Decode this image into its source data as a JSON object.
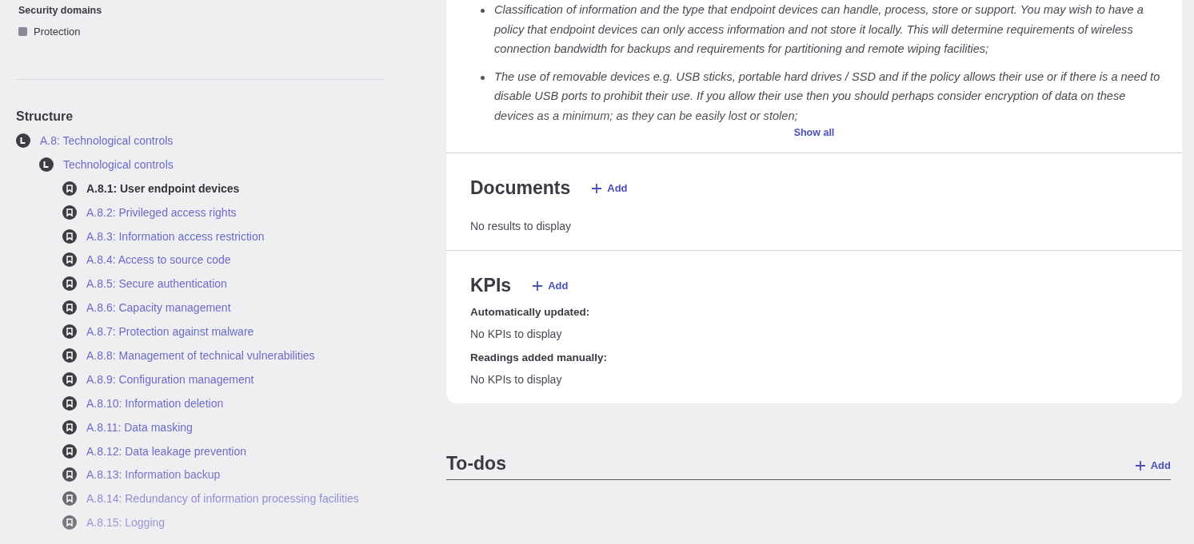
{
  "sidebar": {
    "security_domains": {
      "title": "Security domains",
      "items": [
        {
          "label": "Protection",
          "color": "#8a8796"
        }
      ]
    },
    "structure": {
      "title": "Structure",
      "tree": [
        {
          "label": "A.8: Technological controls",
          "kind": "group",
          "selected": false,
          "children": [
            {
              "label": "Technological controls",
              "kind": "group",
              "selected": false,
              "children": [
                {
                  "label": "A.8.1: User endpoint devices",
                  "kind": "control",
                  "selected": true
                },
                {
                  "label": "A.8.2: Privileged access rights",
                  "kind": "control",
                  "selected": false
                },
                {
                  "label": "A.8.3: Information access restriction",
                  "kind": "control",
                  "selected": false
                },
                {
                  "label": "A.8.4: Access to source code",
                  "kind": "control",
                  "selected": false
                },
                {
                  "label": "A.8.5: Secure authentication",
                  "kind": "control",
                  "selected": false
                },
                {
                  "label": "A.8.6: Capacity management",
                  "kind": "control",
                  "selected": false
                },
                {
                  "label": "A.8.7: Protection against malware",
                  "kind": "control",
                  "selected": false
                },
                {
                  "label": "A.8.8: Management of technical vulnerabilities",
                  "kind": "control",
                  "selected": false
                },
                {
                  "label": "A.8.9: Configuration management",
                  "kind": "control",
                  "selected": false
                },
                {
                  "label": "A.8.10: Information deletion",
                  "kind": "control",
                  "selected": false
                },
                {
                  "label": "A.8.11: Data masking",
                  "kind": "control",
                  "selected": false
                },
                {
                  "label": "A.8.12: Data leakage prevention",
                  "kind": "control",
                  "selected": false
                },
                {
                  "label": "A.8.13: Information backup",
                  "kind": "control",
                  "selected": false
                },
                {
                  "label": "A.8.14: Redundancy of information processing facilities",
                  "kind": "control",
                  "selected": false
                },
                {
                  "label": "A.8.15: Logging",
                  "kind": "control",
                  "selected": false
                }
              ]
            }
          ]
        }
      ]
    }
  },
  "description": {
    "bullets": [
      "Classification of information and the type that endpoint devices can handle, process, store or support. You may wish to have a policy that endpoint devices can only access information and not store it locally. This will determine requirements of wireless connection bandwidth for backups and requirements for partitioning and remote wiping facilities;",
      "The use of removable devices e.g. USB sticks, portable hard drives / SSD and if the policy allows their use or if there is a need to disable USB ports to prohibit their use. If you allow their use then you should perhaps consider encryption of data on these devices as a minimum; as they can be easily lost or stolen;"
    ],
    "show_all": "Show all"
  },
  "documents": {
    "title": "Documents",
    "add": "Add",
    "empty": "No results to display"
  },
  "kpis": {
    "title": "KPIs",
    "add": "Add",
    "groups": [
      {
        "label": "Automatically updated:",
        "empty": "No KPIs to display"
      },
      {
        "label": "Readings added manually:",
        "empty": "No KPIs to display"
      }
    ]
  },
  "todos": {
    "title": "To-dos",
    "add": "Add"
  }
}
